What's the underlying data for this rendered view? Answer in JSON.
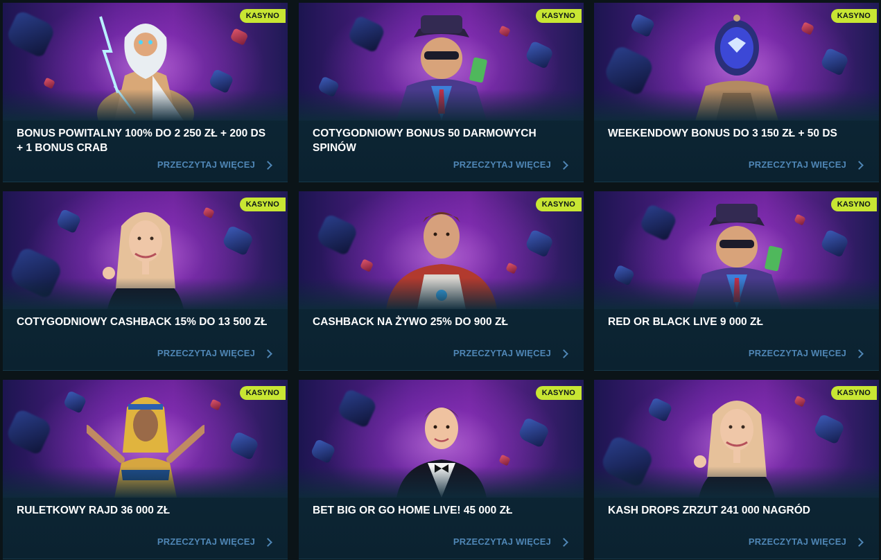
{
  "promotions": [
    {
      "title": "BONUS POWITALNY 100% DO 2 250 ZŁ + 200 DS + 1 BONUS CRAB",
      "badge": "KASYNO",
      "link": "PRZECZYTAJ WIĘCEJ",
      "figure": "zeus-icon"
    },
    {
      "title": "COTYGODNIOWY BONUS 50 DARMOWYCH SPINÓW",
      "badge": "KASYNO",
      "link": "PRZECZYTAJ WIĘCEJ",
      "figure": "gangster-icon"
    },
    {
      "title": "WEEKENDOWY BONUS DO 3 150 ZŁ + 50 DS",
      "badge": "KASYNO",
      "link": "PRZECZYTAJ WIĘCEJ",
      "figure": "robot-icon"
    },
    {
      "title": "COTYGODNIOWY CASHBACK 15% DO 13 500 ZŁ",
      "badge": "KASYNO",
      "link": "PRZECZYTAJ WIĘCEJ",
      "figure": "dealer-woman-icon"
    },
    {
      "title": "CASHBACK NA ŻYWO 25% DO 900 ZŁ",
      "badge": "KASYNO",
      "link": "PRZECZYTAJ WIĘCEJ",
      "figure": "astronaut-icon"
    },
    {
      "title": "RED OR BLACK LIVE 9 000 ZŁ",
      "badge": "KASYNO",
      "link": "PRZECZYTAJ WIĘCEJ",
      "figure": "gangster-icon"
    },
    {
      "title": "RULETKOWY RAJD 36 000 ZŁ",
      "badge": "KASYNO",
      "link": "PRZECZYTAJ WIĘCEJ",
      "figure": "pharaoh-icon"
    },
    {
      "title": "BET BIG OR GO HOME LIVE! 45 000 ZŁ",
      "badge": "KASYNO",
      "link": "PRZECZYTAJ WIĘCEJ",
      "figure": "dealer-man-icon"
    },
    {
      "title": "KASH DROPS ZRZUT 241 000 NAGRÓD",
      "badge": "KASYNO",
      "link": "PRZECZYTAJ WIĘCEJ",
      "figure": "dealer-woman-icon"
    }
  ],
  "colors": {
    "badge": "#c8e633",
    "link": "#4f86b5",
    "card": "#0e2a3a",
    "page": "#0b1418"
  }
}
